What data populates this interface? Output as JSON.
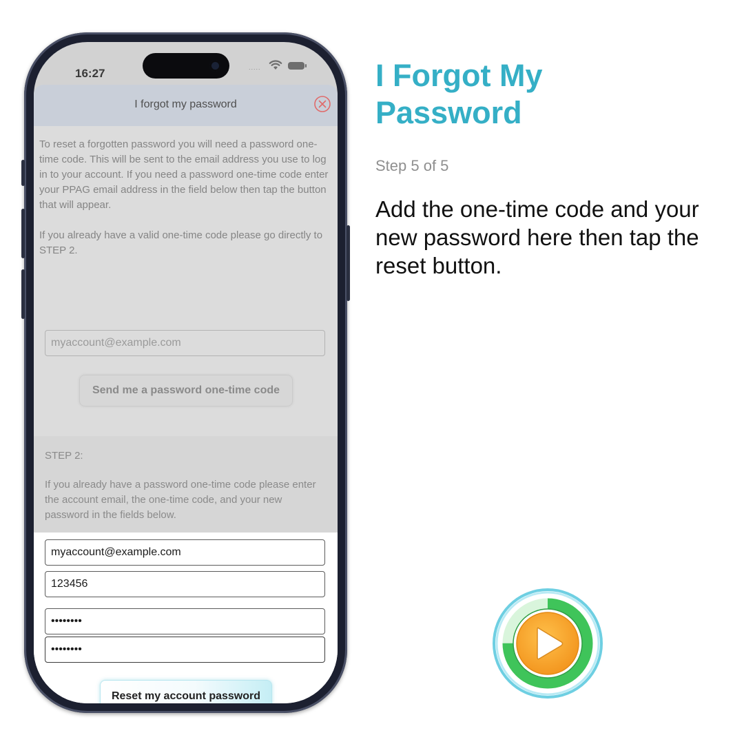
{
  "status_bar": {
    "time": "16:27",
    "signal": "....."
  },
  "sheet": {
    "title": "I forgot my password",
    "intro_paragraph_1": "To reset a forgotten password you will need a password one-time code.  This will be sent to the email address you use to log in to your account.  If you need a password one-time code enter your PPAG email address in the field below then tap the button that will appear.",
    "intro_paragraph_2": "If you already have a valid one-time code please go directly to STEP 2.",
    "email_placeholder": "myaccount@example.com",
    "send_code_label": "Send me a password one-time code",
    "step2_label": "STEP 2:",
    "step2_text": "If you already have a password one-time code please enter the account email, the one-time code, and your new password in the fields below.",
    "step2_email_value": "myaccount@example.com",
    "step2_code_value": "123456",
    "step2_new_password_value": "12345678",
    "step2_confirm_password_value": "12345678",
    "reset_label": "Reset my account password"
  },
  "tutorial": {
    "heading": "I Forgot My Password",
    "step_indicator": "Step 5 of 5",
    "instruction": "Add the one-time code and your new password here then tap the reset button.",
    "progress": 0.75
  },
  "colors": {
    "accent": "#35afc6",
    "play_orange": "#f7a52a",
    "progress_green": "#3fc45a",
    "close_red": "#e06a6a"
  },
  "icons": {
    "close": "close-circle-icon",
    "play": "play-icon",
    "wifi": "wifi-icon",
    "battery": "battery-icon"
  }
}
